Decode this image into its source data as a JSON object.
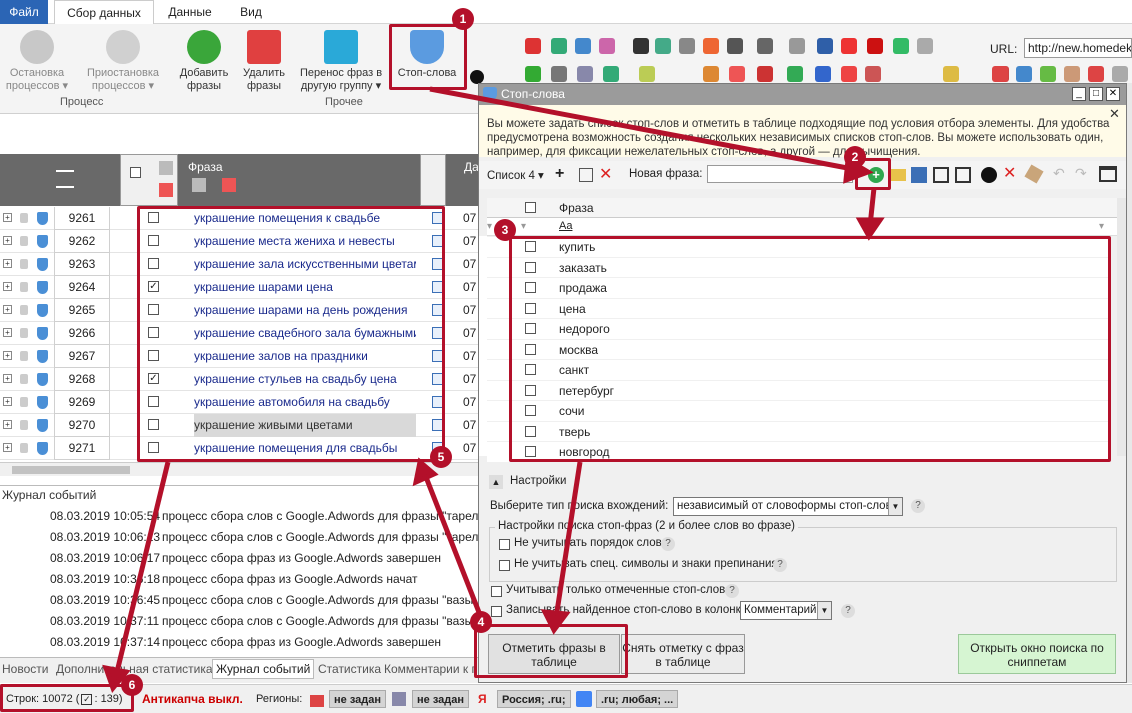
{
  "menu": {
    "file": "Файл",
    "tabs": [
      "Сбор данных",
      "Данные",
      "Вид"
    ]
  },
  "ribbon": {
    "buttons": [
      {
        "label": "Остановка процессов ▾"
      },
      {
        "label": "Приостановка процессов ▾"
      },
      {
        "label": "Добавить фразы"
      },
      {
        "label": "Удалить фразы"
      },
      {
        "label": "Перенос фраз в другую группу ▾"
      },
      {
        "label": "Стоп-слова"
      }
    ],
    "groups": [
      "Процесс",
      "Прочее"
    ],
    "url_label": "URL:",
    "url_value": "http://new.homedek"
  },
  "grid": {
    "col_phrase": "Фраза",
    "col_date": "Да",
    "rows": [
      {
        "id": "9261",
        "phrase": "украшение помещения к свадьбе",
        "checked": false,
        "date": "07"
      },
      {
        "id": "9262",
        "phrase": "украшение места жениха и невесты",
        "checked": false,
        "date": "07"
      },
      {
        "id": "9263",
        "phrase": "украшение зала искусственными цветам",
        "checked": false,
        "date": "07"
      },
      {
        "id": "9264",
        "phrase": "украшение шарами цена",
        "checked": true,
        "date": "07"
      },
      {
        "id": "9265",
        "phrase": "украшение шарами на день рождения",
        "checked": false,
        "date": "07"
      },
      {
        "id": "9266",
        "phrase": "украшение свадебного зала бумажными",
        "checked": false,
        "date": "07"
      },
      {
        "id": "9267",
        "phrase": "украшение залов на праздники",
        "checked": false,
        "date": "07"
      },
      {
        "id": "9268",
        "phrase": "украшение стульев на свадьбу цена",
        "checked": true,
        "date": "07"
      },
      {
        "id": "9269",
        "phrase": "украшение автомобиля на свадьбу",
        "checked": false,
        "date": "07"
      },
      {
        "id": "9270",
        "phrase": "украшение живыми цветами",
        "checked": false,
        "date": "07"
      },
      {
        "id": "9271",
        "phrase": "украшение помещения для свадьбы",
        "checked": false,
        "date": "07"
      }
    ]
  },
  "log": {
    "title": "Журнал событий",
    "rows": [
      {
        "time": "08.03.2019 10:05:54",
        "text": "процесс сбора слов с Google.Adwords для фразы \"тарелк"
      },
      {
        "time": "08.03.2019 10:06:13",
        "text": "процесс сбора слов с Google.Adwords для фразы \"тарелк"
      },
      {
        "time": "08.03.2019 10:06:17",
        "text": "процесс сбора фраз из Google.Adwords завершен"
      },
      {
        "time": "08.03.2019 10:36:18",
        "text": "процесс сбора фраз из Google.Adwords начат"
      },
      {
        "time": "08.03.2019 10:36:45",
        "text": "процесс сбора слов с Google.Adwords для фразы \"вазы"
      },
      {
        "time": "08.03.2019 10:37:11",
        "text": "процесс сбора слов с Google.Adwords для фразы \"вазы"
      },
      {
        "time": "08.03.2019 10:37:14",
        "text": "процесс сбора фраз из Google.Adwords завершен"
      }
    ]
  },
  "bottom_tabs": [
    "Новости",
    "Дополнительная статистика",
    "Журнал событий",
    "Статистика",
    "Комментарии к г"
  ],
  "status": {
    "rows": "Строк: 10072 (",
    "rows_tail": ": 139)",
    "anticaptcha": "Антикапча выкл.",
    "regions": "Регионы:",
    "r1": "не задан",
    "r2": "не задан",
    "r3": "Россия; .ru;",
    "r4": ".ru; любая; ..."
  },
  "dialog": {
    "title": "Стоп-слова",
    "info": "Вы можете задать список стоп-слов и отметить в таблице подходящие под условия отбора элементы. Для удобства предусмотрена возможность создания нескольких независимых списков стоп-слов. Вы можете использовать один, например, для фиксации нежелательных стоп-слов, а другой — для вычищения.",
    "list_select": "Список 4",
    "new_phrase_label": "Новая фраза:",
    "new_phrase_value": "",
    "col_phrase": "Фраза",
    "filter_placeholder": "Aa",
    "words": [
      "купить",
      "заказать",
      "продажа",
      "цена",
      "недорого",
      "москва",
      "санкт",
      "петербург",
      "сочи",
      "тверь",
      "новгород"
    ],
    "settings_label": "Настройки",
    "search_type_label": "Выберите тип поиска вхождений:",
    "search_type_value": "независимый от словоформы стоп-слова",
    "group_title": "Настройки поиска стоп-фраз (2 и более слов во фразе)",
    "opt_order": "Не учитывать порядок слов",
    "opt_symbols": "Не учитывать спец. символы и знаки препинания",
    "opt_marked": "Учитывать только отмеченные стоп-слова",
    "opt_write": "Записывать найденное стоп-слово в колонку",
    "column_value": "Комментарий",
    "btn_mark": "Отметить фразы в таблице",
    "btn_unmark": "Снять отметку с фраз в таблице",
    "btn_snippets": "Открыть окно поиска по сниппетам"
  },
  "badges": [
    "1",
    "2",
    "3",
    "4",
    "5",
    "6"
  ],
  "colors": {
    "accent": "#b3102a",
    "file_tab": "#2b65b5",
    "green_btn": "#d6f5d2"
  }
}
